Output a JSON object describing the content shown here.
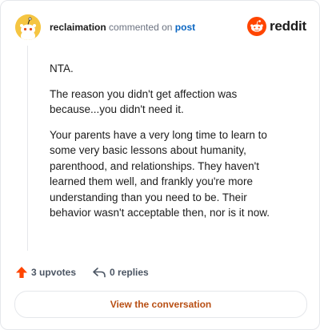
{
  "header": {
    "username": "reclaimation",
    "action": "commented on",
    "post_link": "post"
  },
  "brand": {
    "name": "reddit",
    "color": "#ff4500"
  },
  "comment": {
    "paragraphs": [
      "NTA.",
      "The reason you didn't get affection was because...you didn't need it.",
      "Your parents have a very long time to learn to some very basic lessons about humanity, parenthood, and relationships. They haven't learned them well, and frankly you're more understanding than you need to be. Their behavior wasn't acceptable then, nor is it now."
    ]
  },
  "footer": {
    "upvotes": "3 upvotes",
    "replies": "0 replies"
  },
  "cta": {
    "label": "View the conversation"
  },
  "colors": {
    "upvote": "#ff4500",
    "cta_text": "#b84f14",
    "link": "#0a66c2",
    "avatar": "#f5c542"
  }
}
